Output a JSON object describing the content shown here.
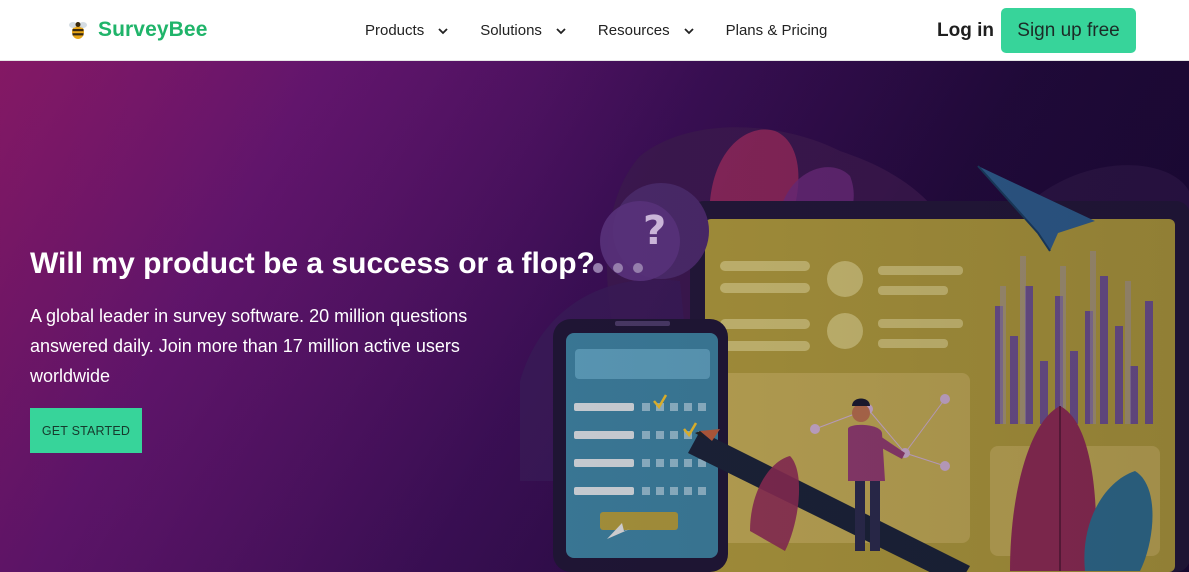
{
  "brand": {
    "name": "SurveyBee",
    "logo_icon": "bee-icon",
    "accent": "#37d49a",
    "brand_color": "#20b46a"
  },
  "nav": {
    "items": [
      {
        "label": "Products",
        "has_dropdown": true
      },
      {
        "label": "Solutions",
        "has_dropdown": true
      },
      {
        "label": "Resources",
        "has_dropdown": true
      },
      {
        "label": "Plans & Pricing",
        "has_dropdown": false
      }
    ],
    "login_label": "Log in",
    "signup_label": "Sign up free"
  },
  "hero": {
    "title": "Will my product be a success or a flop?",
    "subtitle": "A global leader in survey software. 20 million questions answered daily. Join more than 17 million active users worldwide",
    "cta_label": "GET STARTED",
    "illustration": "survey-dashboard-illustration"
  }
}
